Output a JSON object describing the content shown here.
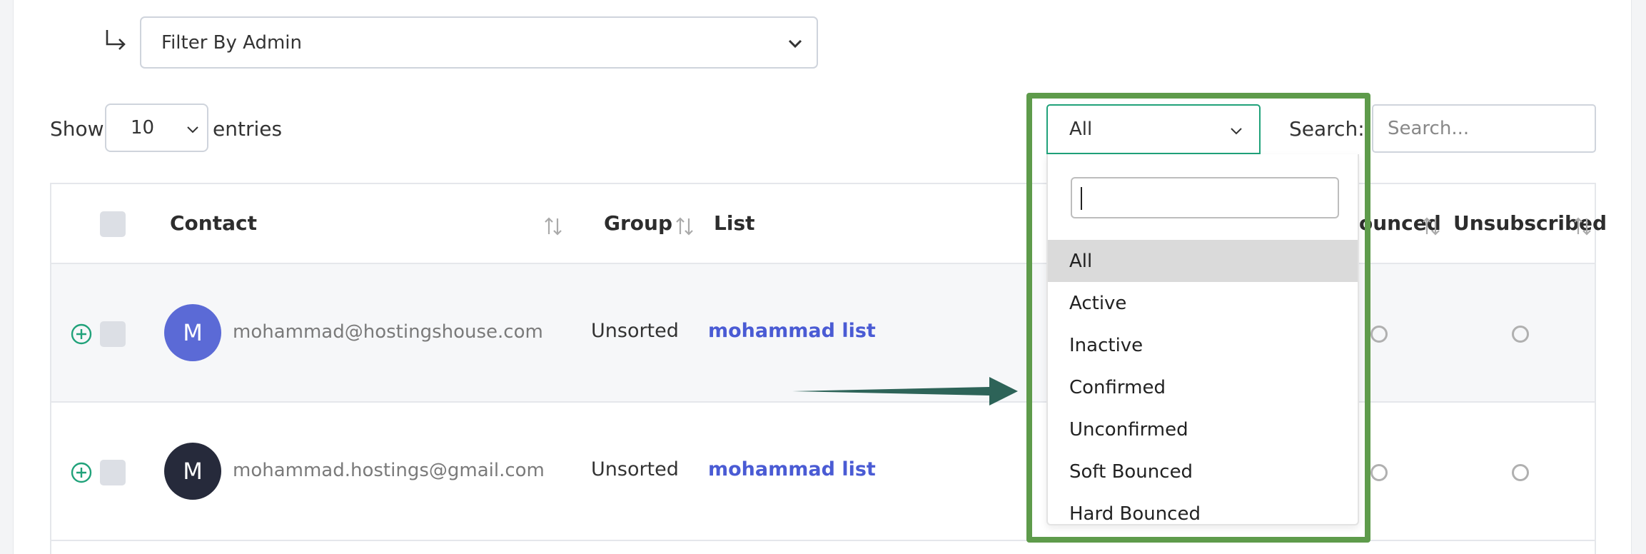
{
  "filter": {
    "label": "Filter By Admin"
  },
  "length": {
    "show": "Show",
    "value": "10",
    "entries": "entries"
  },
  "status_filter": {
    "selected": "All",
    "options": [
      "All",
      "Active",
      "Inactive",
      "Confirmed",
      "Unconfirmed",
      "Soft Bounced",
      "Hard Bounced"
    ]
  },
  "search": {
    "label": "Search:",
    "placeholder": "Search..."
  },
  "table": {
    "headers": {
      "contact": "Contact",
      "group": "Group",
      "list": "List",
      "bounced": "ounced",
      "unsubscribed": "Unsubscribed"
    },
    "rows": [
      {
        "initial": "M",
        "avatar_color": "#5b6ad6",
        "email": "mohammad@hostingshouse.com",
        "group": "Unsorted",
        "list": "mohammad list"
      },
      {
        "initial": "M",
        "avatar_color": "#262a3b",
        "email": "mohammad.hostings@gmail.com",
        "group": "Unsorted",
        "list": "mohammad list"
      }
    ]
  },
  "colors": {
    "accent_green": "#20a27a",
    "highlight": "#5e9b4b",
    "link": "#4a5bd4",
    "arrow": "#2d6358"
  }
}
